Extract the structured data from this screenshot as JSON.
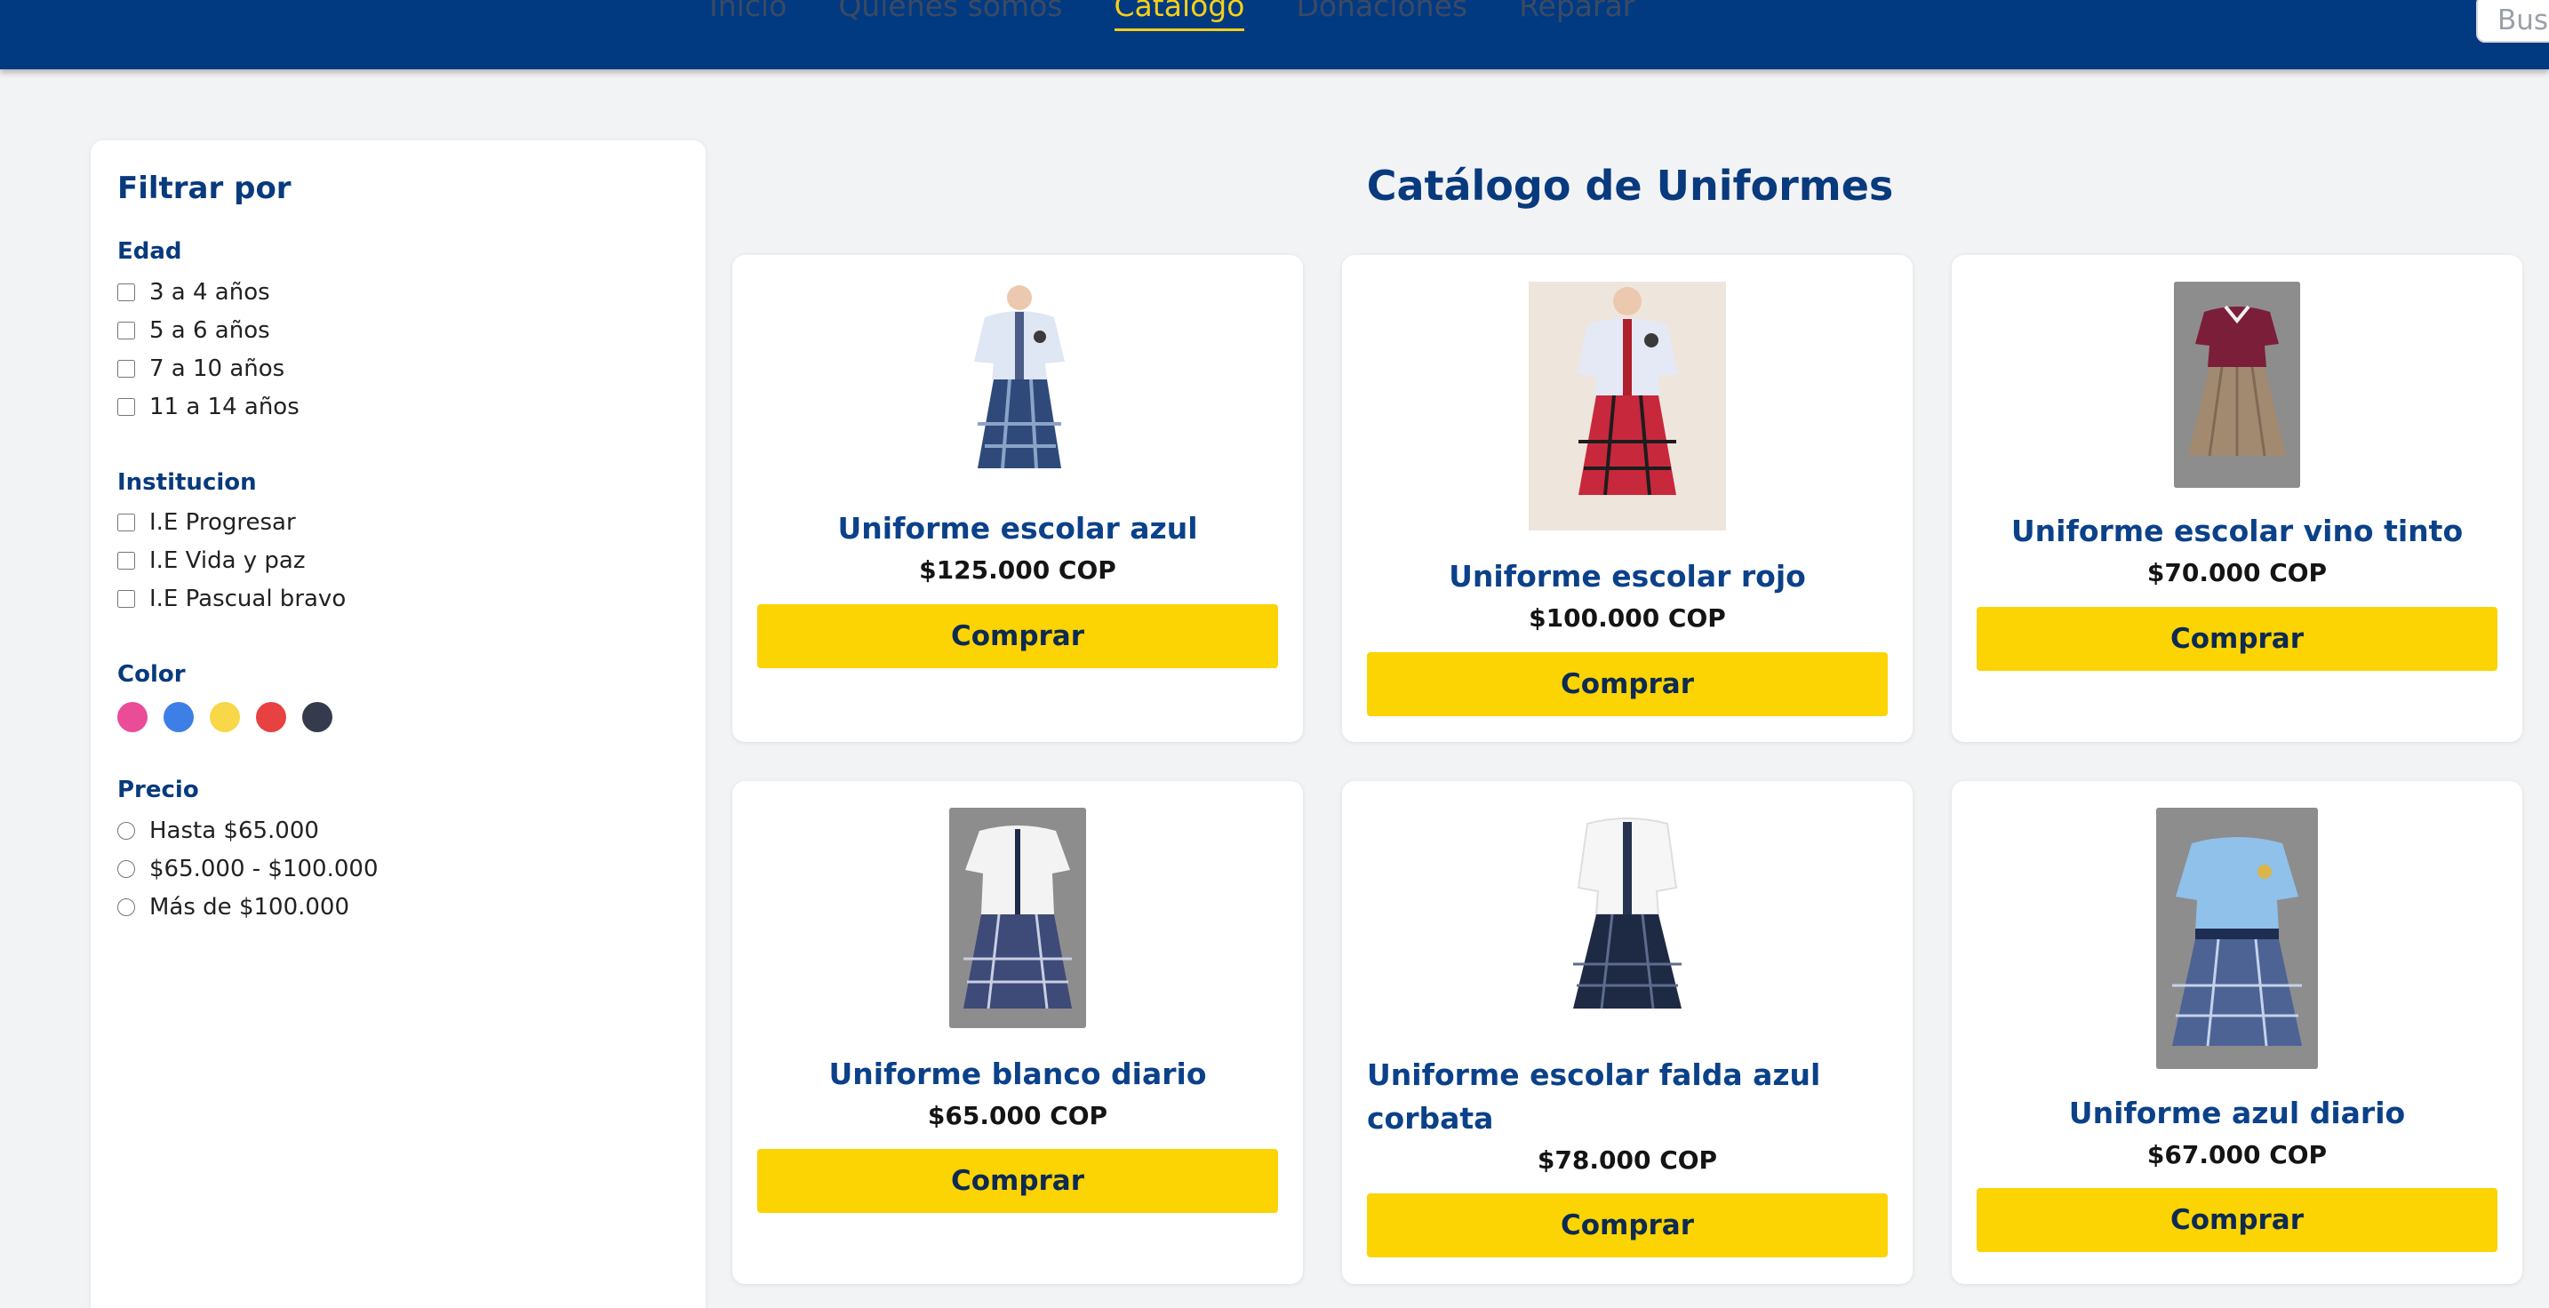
{
  "nav": {
    "items": [
      {
        "label": "Inicio",
        "active": false
      },
      {
        "label": "Quiénes somos",
        "active": false
      },
      {
        "label": "Catalogo",
        "active": true
      },
      {
        "label": "Donaciones",
        "active": false
      },
      {
        "label": "Reparar",
        "active": false
      }
    ],
    "search_placeholder": "Busc"
  },
  "colors": {
    "header": "#023a82",
    "accent_yellow": "#fcd303",
    "title_blue": "#083a7d"
  },
  "sidebar": {
    "title": "Filtrar por",
    "edad": {
      "title": "Edad",
      "options": [
        "3 a 4 años",
        "5 a 6 años",
        "7 a 10 años",
        "11 a 14 años"
      ]
    },
    "institucion": {
      "title": "Institucion",
      "options": [
        "I.E Progresar",
        "I.E Vida y paz",
        "I.E Pascual bravo"
      ]
    },
    "color": {
      "title": "Color",
      "swatches": [
        "#ea4c98",
        "#3d7fe6",
        "#f8d748",
        "#e84141",
        "#353b4c"
      ]
    },
    "precio": {
      "title": "Precio",
      "options": [
        "Hasta $65.000",
        "$65.000 - $100.000",
        "Más de $100.000"
      ]
    }
  },
  "main": {
    "title": "Catálogo de Uniformes",
    "buy_label": "Comprar",
    "products": [
      {
        "name": "Uniforme escolar azul",
        "price": "$125.000 COP",
        "image": "uniform-blue-plaid-tie"
      },
      {
        "name": "Uniforme escolar rojo",
        "price": "$100.000 COP",
        "image": "uniform-red-plaid-tie"
      },
      {
        "name": "Uniforme escolar vino tinto",
        "price": "$70.000 COP",
        "image": "uniform-wine-polo-khaki-skirt"
      },
      {
        "name": "Uniforme blanco diario",
        "price": "$65.000 COP",
        "image": "uniform-white-shirt-navy-plaid"
      },
      {
        "name": "Uniforme escolar falda azul corbata",
        "price": "$78.000 COP",
        "image": "uniform-white-shirt-navy-skirt-tie"
      },
      {
        "name": "Uniforme azul diario",
        "price": "$67.000 COP",
        "image": "uniform-lightblue-shirt-plaid"
      }
    ]
  }
}
